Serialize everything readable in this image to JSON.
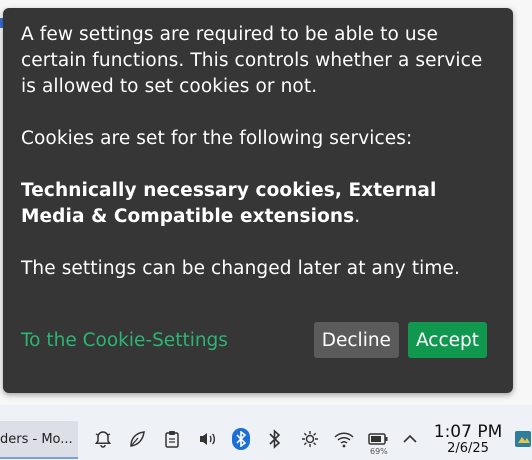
{
  "cookie_dialog": {
    "para1": "A few settings are required to be able to use certain functions. This controls whether a service is allowed to set cookies or not.",
    "para2": "Cookies are set for the following services:",
    "para3_bold": "Technically necessary cookies, External Media & Compatible extensions",
    "para3_tail": ".",
    "para4": "The settings can be changed later at any time.",
    "settings_link": "To the Cookie-Settings",
    "decline_label": "Decline",
    "accept_label": "Accept"
  },
  "taskbar": {
    "active_window_label": "ders - Mo...",
    "tray_icons": [
      "notifications-icon",
      "leaf-icon",
      "clipboard-icon",
      "speaker-icon",
      "bluetooth-icon",
      "bluetooth-alt-icon",
      "brightness-icon",
      "wifi-icon",
      "battery-icon",
      "chevron-up-icon"
    ],
    "battery_percent": "69%",
    "clock_time": "1:07 PM",
    "clock_date": "2/6/25"
  },
  "colors": {
    "dialog_bg": "#363636",
    "link_green": "#2bb673",
    "accept_green": "#10984e",
    "decline_gray": "#5b5b5b"
  }
}
